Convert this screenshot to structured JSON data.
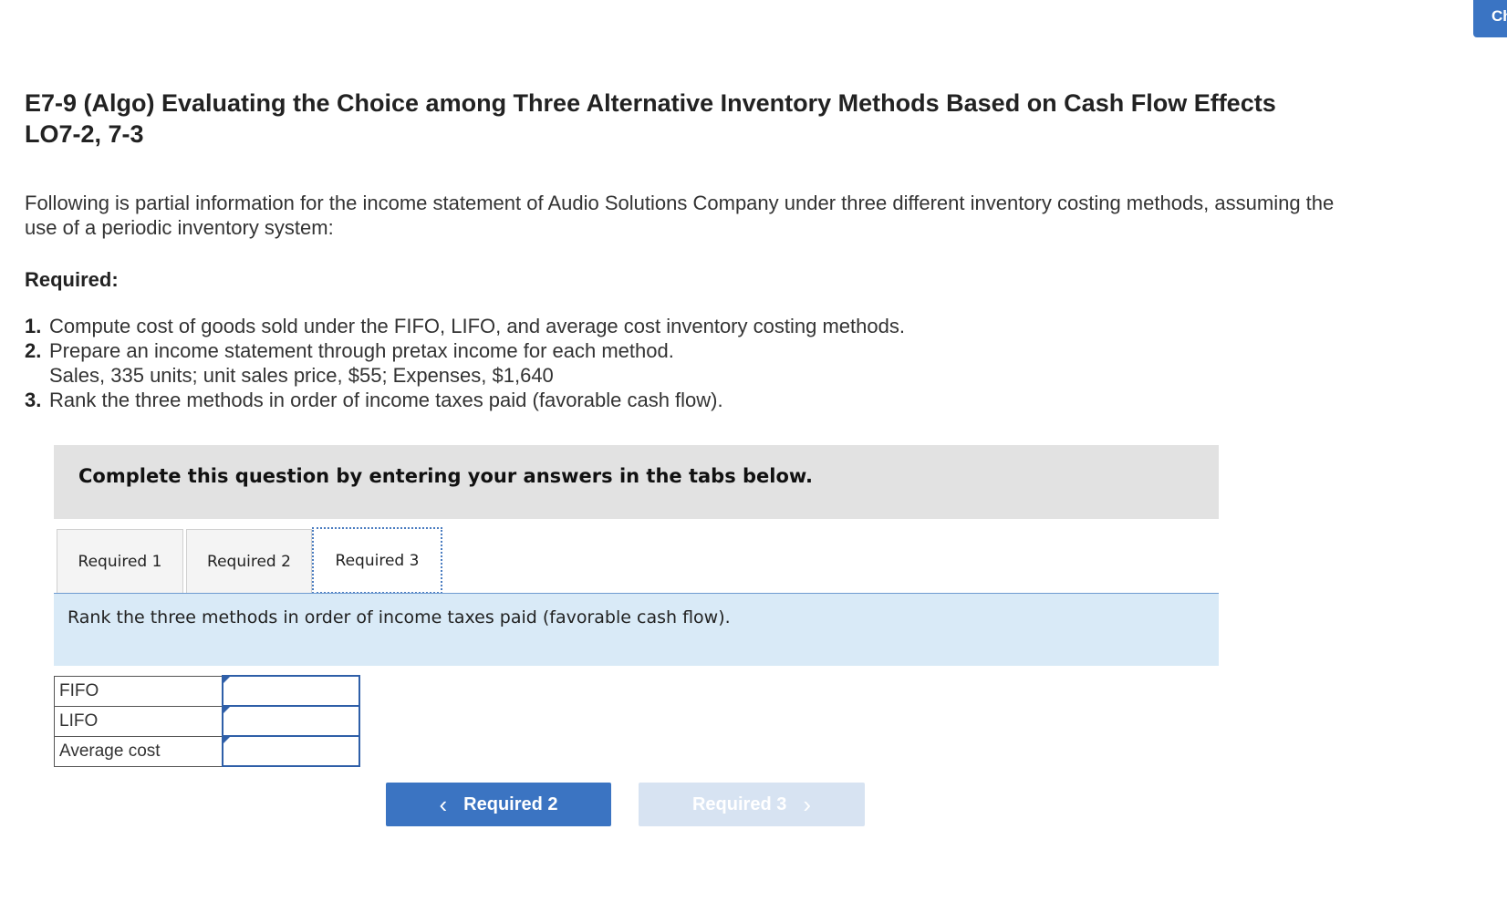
{
  "corner_button": {
    "label": "Ch"
  },
  "title": "E7-9 (Algo) Evaluating the Choice among Three Alternative Inventory Methods Based on Cash Flow Effects LO7-2, 7-3",
  "intro": "Following is partial information for the income statement of Audio Solutions Company under three different inventory costing methods, assuming the use of a periodic inventory system:",
  "required_heading": "Required:",
  "requirements": [
    {
      "num": "1.",
      "text": "Compute cost of goods sold under the FIFO, LIFO, and average cost inventory costing methods."
    },
    {
      "num": "2.",
      "text": "Prepare an income statement through pretax income for each method.",
      "sub": "Sales, 335 units; unit sales price, $55; Expenses, $1,640"
    },
    {
      "num": "3.",
      "text": "Rank the three methods in order of income taxes paid (favorable cash flow)."
    }
  ],
  "instruction_box": "Complete this question by entering your answers in the tabs below.",
  "tabs": [
    {
      "label": "Required 1"
    },
    {
      "label": "Required 2"
    },
    {
      "label": "Required 3",
      "active": true
    }
  ],
  "panel_text": "Rank the three methods in order of income taxes paid (favorable cash flow).",
  "answer_rows": [
    {
      "label": "FIFO",
      "value": ""
    },
    {
      "label": "LIFO",
      "value": ""
    },
    {
      "label": "Average cost",
      "value": ""
    }
  ],
  "nav": {
    "prev_label": "Required 2",
    "next_label": "Required 3",
    "prev_chevron": "‹",
    "next_chevron": "›"
  },
  "colors": {
    "accent": "#3b74c2",
    "panel_bg": "#d9eaf7",
    "instruction_bg": "#e2e2e2",
    "disabled_button": "#d7e3f2"
  }
}
